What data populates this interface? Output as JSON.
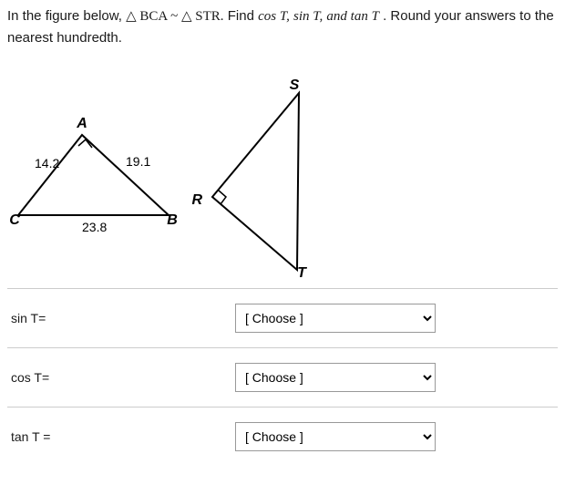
{
  "question": {
    "prefix": "In the figure below, ",
    "sim": " △ BCA ~ △ STR.",
    "mid": "  Find ",
    "find1": "cos T,",
    "find2": " sin T,",
    "find3": " and tan T",
    "suffix": ". Round your answers to the nearest hundredth."
  },
  "figure": {
    "leftTriangle": {
      "A": "A",
      "B": "B",
      "C": "C",
      "CA": "14.2",
      "AB": "19.1",
      "CB": "23.8"
    },
    "rightTriangle": {
      "S": "S",
      "T": "T",
      "R": "R"
    }
  },
  "answers": {
    "row1": {
      "label": "sin T=",
      "placeholder": "[ Choose ]"
    },
    "row2": {
      "label": "cos T=",
      "placeholder": "[ Choose ]"
    },
    "row3": {
      "label": "tan T =",
      "placeholder": "[ Choose ]"
    }
  }
}
